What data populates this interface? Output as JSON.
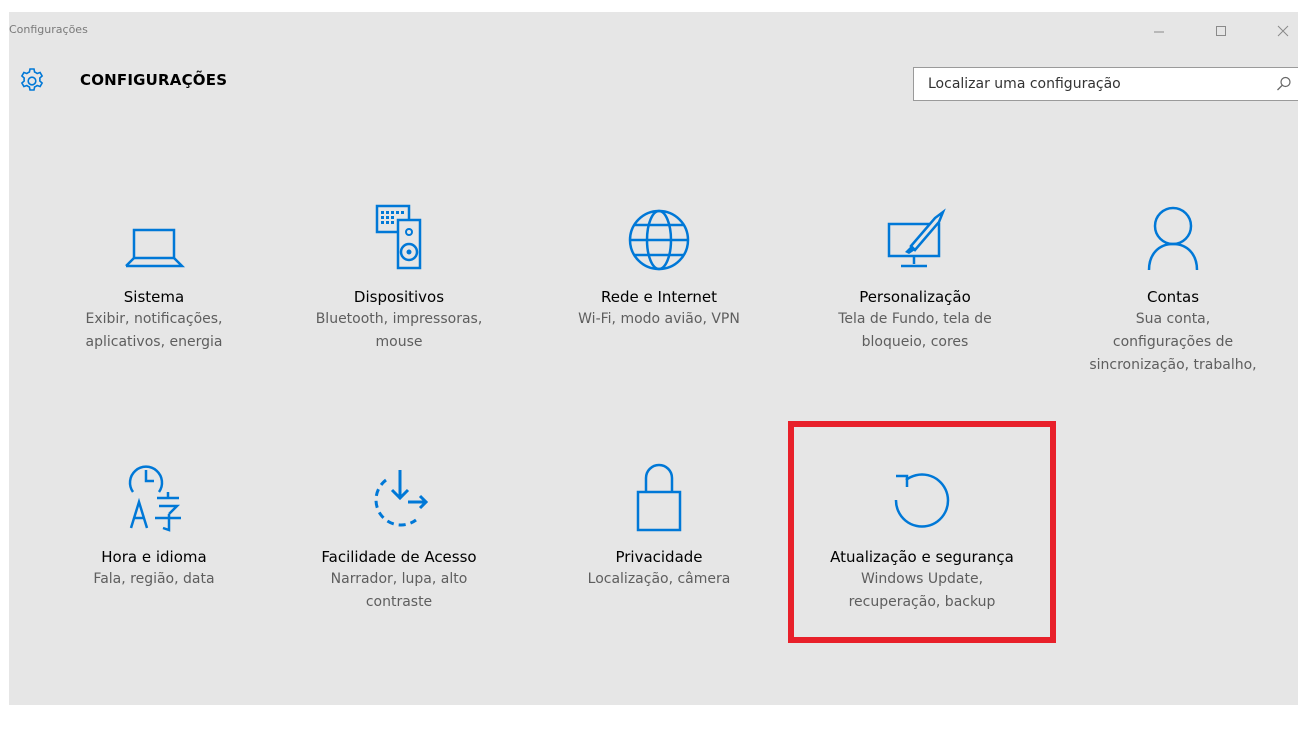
{
  "window": {
    "title": "Configurações",
    "controls": {
      "minimize_icon": "minimize-icon",
      "maximize_icon": "maximize-icon",
      "close_icon": "close-icon"
    }
  },
  "header": {
    "title": "CONFIGURAÇÕES",
    "icon": "gear-icon"
  },
  "search": {
    "placeholder": "Localizar uma configuração",
    "value": "",
    "icon": "search-icon"
  },
  "colors": {
    "accent": "#0078d7",
    "highlight": "#e8202a",
    "background": "#e6e6e6"
  },
  "tiles": [
    {
      "name": "Sistema",
      "desc": [
        "Exibir, notificações,",
        "aplicativos, energia"
      ],
      "icon": "laptop-icon"
    },
    {
      "name": "Dispositivos",
      "desc": [
        "Bluetooth, impressoras,",
        "mouse"
      ],
      "icon": "devices-icon"
    },
    {
      "name": "Rede e Internet",
      "desc": [
        "Wi-Fi, modo avião, VPN"
      ],
      "icon": "globe-icon"
    },
    {
      "name": "Personalização",
      "desc": [
        "Tela de Fundo, tela de",
        "bloqueio, cores"
      ],
      "icon": "personalization-icon"
    },
    {
      "name": "Contas",
      "desc": [
        "Sua conta,",
        "configurações de",
        "sincronização, trabalho,"
      ],
      "icon": "account-icon"
    },
    {
      "name": "Hora e idioma",
      "desc": [
        "Fala, região, data"
      ],
      "icon": "time-language-icon"
    },
    {
      "name": "Facilidade de Acesso",
      "desc": [
        "Narrador, lupa, alto",
        "contraste"
      ],
      "icon": "ease-of-access-icon"
    },
    {
      "name": "Privacidade",
      "desc": [
        "Localização, câmera"
      ],
      "icon": "lock-icon"
    },
    {
      "name": "Atualização e segurança",
      "desc": [
        "Windows Update,",
        "recuperação, backup"
      ],
      "icon": "update-icon",
      "highlighted": true
    }
  ]
}
